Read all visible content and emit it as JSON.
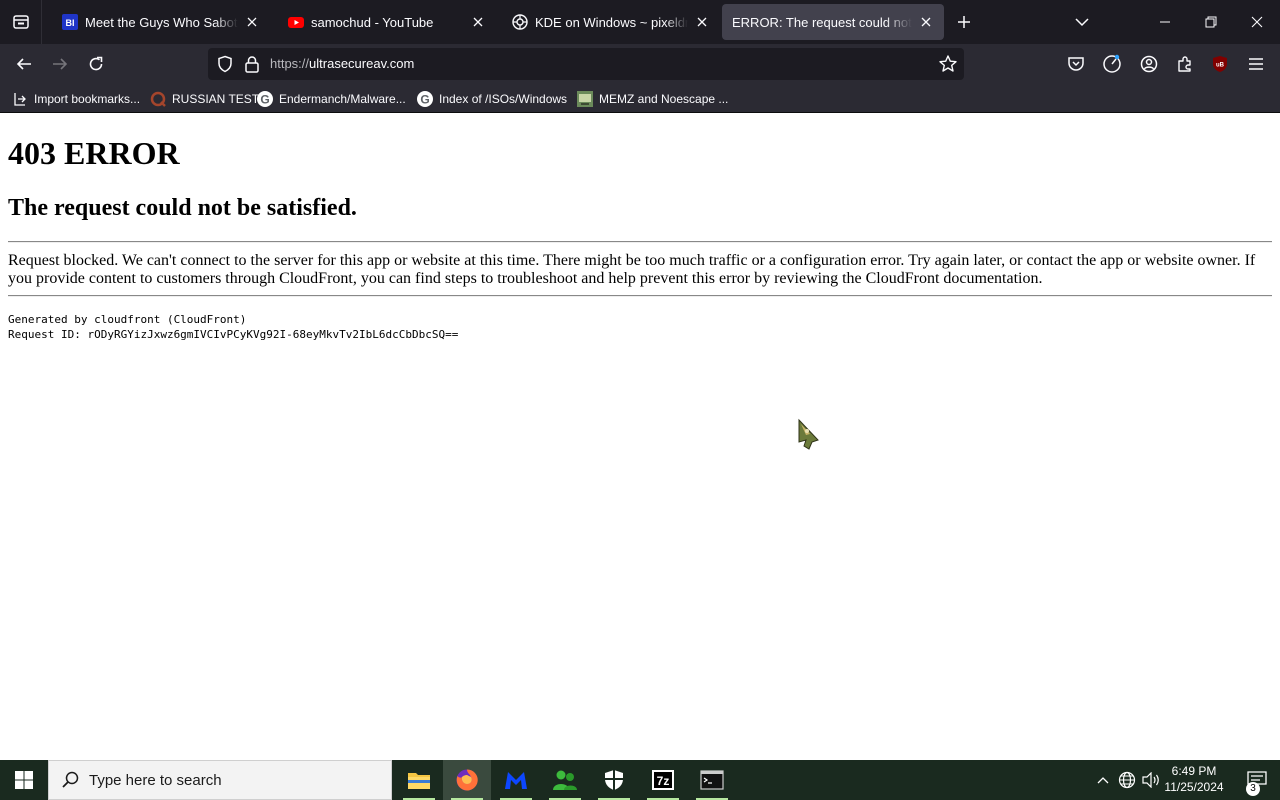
{
  "browser": {
    "tabs": [
      {
        "title": "Meet the Guys Who Sabotaged",
        "favicon": "bi-logo",
        "active": false
      },
      {
        "title": "samochud - YouTube",
        "favicon": "youtube-logo",
        "active": false
      },
      {
        "title": "KDE on Windows ~ pixeldrain",
        "favicon": "pixeldrain-logo",
        "active": false
      },
      {
        "title": "ERROR: The request could not be satisfied",
        "favicon": "",
        "active": true
      }
    ],
    "url": {
      "protocol": "https://",
      "host": "ultrasecureav.com"
    },
    "bookmarks": [
      {
        "label": "Import bookmarks...",
        "icon": "import-icon"
      },
      {
        "label": "RUSSIAN TEST",
        "icon": "russian-test-favicon"
      },
      {
        "label": "Endermanch/Malware...",
        "icon": "google-favicon"
      },
      {
        "label": "Index of /ISOs/Windows",
        "icon": "google-favicon"
      },
      {
        "label": "MEMZ and Noescape ...",
        "icon": "memz-favicon"
      }
    ],
    "extension_badge": "uB"
  },
  "page": {
    "heading": "403 ERROR",
    "subheading": "The request could not be satisfied.",
    "message": "Request blocked. We can't connect to the server for this app or website at this time. There might be too much traffic or a configuration error. Try again later, or contact the app or website owner. If you provide content to customers through CloudFront, you can find steps to troubleshoot and help prevent this error by reviewing the CloudFront documentation.",
    "generated_by": "Generated by cloudfront (CloudFront)",
    "request_id": "Request ID: rODyRGYizJxwz6gmIVCIvPCyKVg92I-68eyMkvTv2IbL6dcCbDbcSQ=="
  },
  "taskbar": {
    "search_placeholder": "Type here to search",
    "apps": [
      "file-explorer",
      "firefox",
      "malwarebytes",
      "people",
      "windows-security",
      "7zip",
      "terminal"
    ],
    "active_app": "firefox",
    "clock_time": "6:49 PM",
    "clock_date": "11/25/2024",
    "notification_count": "3"
  },
  "colors": {
    "tabstrip_bg": "#1c1b22",
    "toolbar_bg": "#2b2a33",
    "active_tab_bg": "#42414d",
    "taskbar_bg": "#1a2a1f"
  }
}
